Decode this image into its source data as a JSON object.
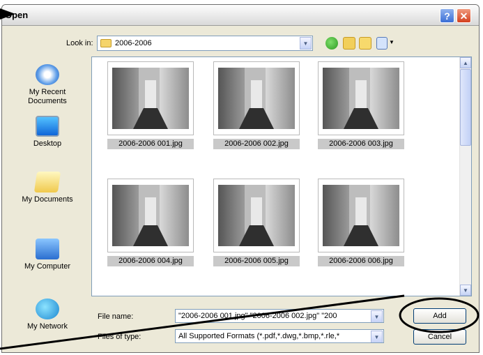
{
  "window": {
    "title": "Open"
  },
  "lookin": {
    "label": "Look in:",
    "value": "2006-2006"
  },
  "places": [
    {
      "label": "My Recent Documents"
    },
    {
      "label": "Desktop"
    },
    {
      "label": "My Documents"
    },
    {
      "label": "My Computer"
    },
    {
      "label": "My Network"
    }
  ],
  "files": [
    {
      "name": "2006-2006 001.jpg"
    },
    {
      "name": "2006-2006 002.jpg"
    },
    {
      "name": "2006-2006 003.jpg"
    },
    {
      "name": "2006-2006 004.jpg"
    },
    {
      "name": "2006-2006 005.jpg"
    },
    {
      "name": "2006-2006 006.jpg"
    }
  ],
  "filename": {
    "label": "File name:",
    "value": "\"2006-2006 001.jpg\" \"2006-2006 002.jpg\" \"200"
  },
  "filetype": {
    "label": "Files of type:",
    "value": "All Supported Formats (*.pdf,*.dwg,*.bmp,*.rle,*"
  },
  "buttons": {
    "add": "Add",
    "cancel": "Cancel"
  },
  "colors": {
    "annotation": "#000000",
    "dialog_bg": "#ece9d8",
    "selection": "#c9c9c9"
  }
}
